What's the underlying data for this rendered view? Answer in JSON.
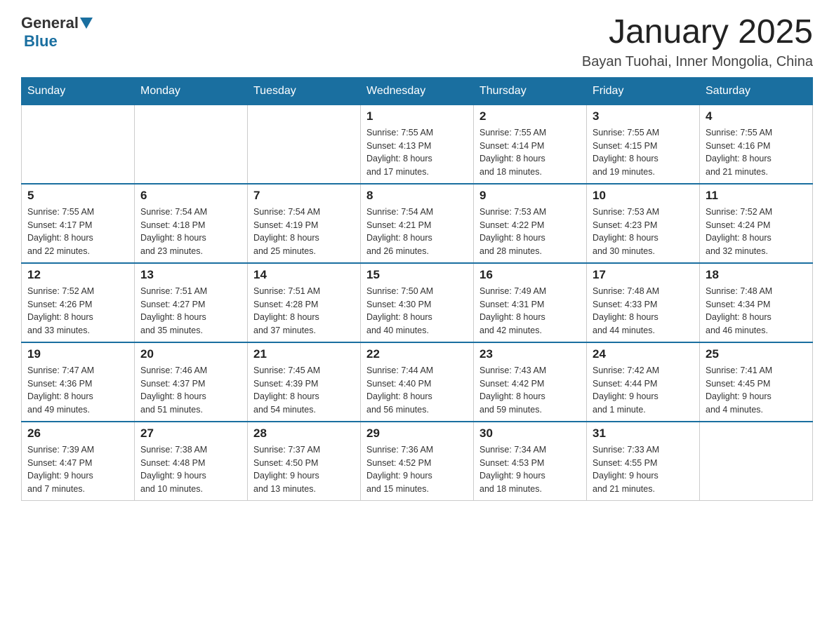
{
  "header": {
    "logo_general": "General",
    "logo_blue": "Blue",
    "month_title": "January 2025",
    "location": "Bayan Tuohai, Inner Mongolia, China"
  },
  "days_of_week": [
    "Sunday",
    "Monday",
    "Tuesday",
    "Wednesday",
    "Thursday",
    "Friday",
    "Saturday"
  ],
  "weeks": [
    {
      "cells": [
        {
          "day": "",
          "info": ""
        },
        {
          "day": "",
          "info": ""
        },
        {
          "day": "",
          "info": ""
        },
        {
          "day": "1",
          "info": "Sunrise: 7:55 AM\nSunset: 4:13 PM\nDaylight: 8 hours\nand 17 minutes."
        },
        {
          "day": "2",
          "info": "Sunrise: 7:55 AM\nSunset: 4:14 PM\nDaylight: 8 hours\nand 18 minutes."
        },
        {
          "day": "3",
          "info": "Sunrise: 7:55 AM\nSunset: 4:15 PM\nDaylight: 8 hours\nand 19 minutes."
        },
        {
          "day": "4",
          "info": "Sunrise: 7:55 AM\nSunset: 4:16 PM\nDaylight: 8 hours\nand 21 minutes."
        }
      ]
    },
    {
      "cells": [
        {
          "day": "5",
          "info": "Sunrise: 7:55 AM\nSunset: 4:17 PM\nDaylight: 8 hours\nand 22 minutes."
        },
        {
          "day": "6",
          "info": "Sunrise: 7:54 AM\nSunset: 4:18 PM\nDaylight: 8 hours\nand 23 minutes."
        },
        {
          "day": "7",
          "info": "Sunrise: 7:54 AM\nSunset: 4:19 PM\nDaylight: 8 hours\nand 25 minutes."
        },
        {
          "day": "8",
          "info": "Sunrise: 7:54 AM\nSunset: 4:21 PM\nDaylight: 8 hours\nand 26 minutes."
        },
        {
          "day": "9",
          "info": "Sunrise: 7:53 AM\nSunset: 4:22 PM\nDaylight: 8 hours\nand 28 minutes."
        },
        {
          "day": "10",
          "info": "Sunrise: 7:53 AM\nSunset: 4:23 PM\nDaylight: 8 hours\nand 30 minutes."
        },
        {
          "day": "11",
          "info": "Sunrise: 7:52 AM\nSunset: 4:24 PM\nDaylight: 8 hours\nand 32 minutes."
        }
      ]
    },
    {
      "cells": [
        {
          "day": "12",
          "info": "Sunrise: 7:52 AM\nSunset: 4:26 PM\nDaylight: 8 hours\nand 33 minutes."
        },
        {
          "day": "13",
          "info": "Sunrise: 7:51 AM\nSunset: 4:27 PM\nDaylight: 8 hours\nand 35 minutes."
        },
        {
          "day": "14",
          "info": "Sunrise: 7:51 AM\nSunset: 4:28 PM\nDaylight: 8 hours\nand 37 minutes."
        },
        {
          "day": "15",
          "info": "Sunrise: 7:50 AM\nSunset: 4:30 PM\nDaylight: 8 hours\nand 40 minutes."
        },
        {
          "day": "16",
          "info": "Sunrise: 7:49 AM\nSunset: 4:31 PM\nDaylight: 8 hours\nand 42 minutes."
        },
        {
          "day": "17",
          "info": "Sunrise: 7:48 AM\nSunset: 4:33 PM\nDaylight: 8 hours\nand 44 minutes."
        },
        {
          "day": "18",
          "info": "Sunrise: 7:48 AM\nSunset: 4:34 PM\nDaylight: 8 hours\nand 46 minutes."
        }
      ]
    },
    {
      "cells": [
        {
          "day": "19",
          "info": "Sunrise: 7:47 AM\nSunset: 4:36 PM\nDaylight: 8 hours\nand 49 minutes."
        },
        {
          "day": "20",
          "info": "Sunrise: 7:46 AM\nSunset: 4:37 PM\nDaylight: 8 hours\nand 51 minutes."
        },
        {
          "day": "21",
          "info": "Sunrise: 7:45 AM\nSunset: 4:39 PM\nDaylight: 8 hours\nand 54 minutes."
        },
        {
          "day": "22",
          "info": "Sunrise: 7:44 AM\nSunset: 4:40 PM\nDaylight: 8 hours\nand 56 minutes."
        },
        {
          "day": "23",
          "info": "Sunrise: 7:43 AM\nSunset: 4:42 PM\nDaylight: 8 hours\nand 59 minutes."
        },
        {
          "day": "24",
          "info": "Sunrise: 7:42 AM\nSunset: 4:44 PM\nDaylight: 9 hours\nand 1 minute."
        },
        {
          "day": "25",
          "info": "Sunrise: 7:41 AM\nSunset: 4:45 PM\nDaylight: 9 hours\nand 4 minutes."
        }
      ]
    },
    {
      "cells": [
        {
          "day": "26",
          "info": "Sunrise: 7:39 AM\nSunset: 4:47 PM\nDaylight: 9 hours\nand 7 minutes."
        },
        {
          "day": "27",
          "info": "Sunrise: 7:38 AM\nSunset: 4:48 PM\nDaylight: 9 hours\nand 10 minutes."
        },
        {
          "day": "28",
          "info": "Sunrise: 7:37 AM\nSunset: 4:50 PM\nDaylight: 9 hours\nand 13 minutes."
        },
        {
          "day": "29",
          "info": "Sunrise: 7:36 AM\nSunset: 4:52 PM\nDaylight: 9 hours\nand 15 minutes."
        },
        {
          "day": "30",
          "info": "Sunrise: 7:34 AM\nSunset: 4:53 PM\nDaylight: 9 hours\nand 18 minutes."
        },
        {
          "day": "31",
          "info": "Sunrise: 7:33 AM\nSunset: 4:55 PM\nDaylight: 9 hours\nand 21 minutes."
        },
        {
          "day": "",
          "info": ""
        }
      ]
    }
  ]
}
